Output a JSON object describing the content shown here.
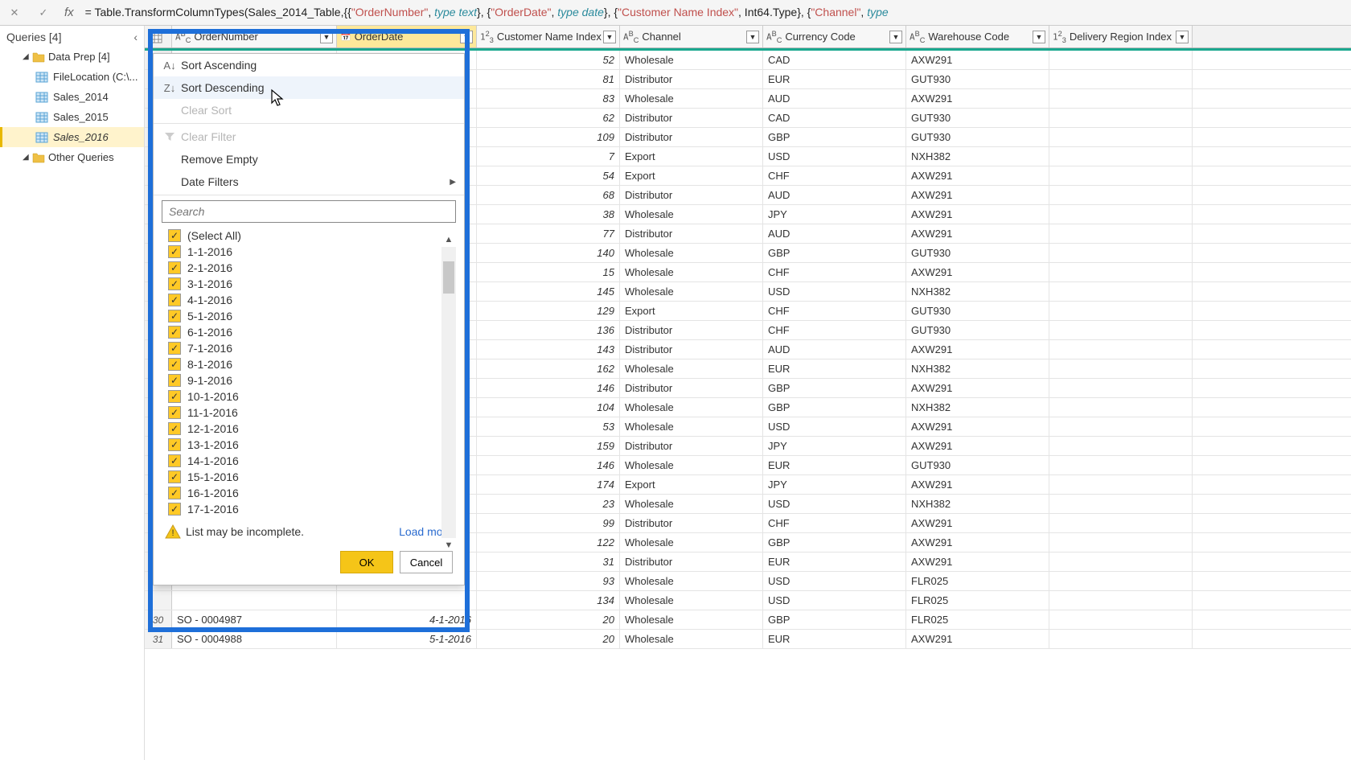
{
  "formula_parts": [
    "= Table.TransformColumnTypes(Sales_2014_Table,{{",
    "\"OrderNumber\"",
    ", ",
    "type text",
    "}, {",
    "\"OrderDate\"",
    ", ",
    "type date",
    "}, {",
    "\"Customer Name Index\"",
    ", Int64.Type}, {",
    "\"Channel\"",
    ", ",
    "type"
  ],
  "sidebar": {
    "title": "Queries [4]",
    "folder": "Data Prep [4]",
    "items": [
      "FileLocation (C:\\...",
      "Sales_2014",
      "Sales_2015",
      "Sales_2016"
    ],
    "other": "Other Queries"
  },
  "columns": [
    {
      "type": "ABC",
      "name": "OrderNumber"
    },
    {
      "type": "cal",
      "name": "OrderDate",
      "sel": true
    },
    {
      "type": "123",
      "name": "Customer Name Index"
    },
    {
      "type": "ABC",
      "name": "Channel"
    },
    {
      "type": "ABC",
      "name": "Currency Code"
    },
    {
      "type": "ABC",
      "name": "Warehouse Code"
    },
    {
      "type": "123",
      "name": "Delivery Region Index"
    }
  ],
  "visible_rows_bottom": [
    {
      "rn": "30",
      "order": "SO - 0004987",
      "date": "4-1-2016",
      "cust": "20",
      "chan": "Wholesale",
      "curr": "GBP",
      "wh": "FLR025"
    },
    {
      "rn": "31",
      "order": "SO - 0004988",
      "date": "5-1-2016",
      "cust": "20",
      "chan": "Wholesale",
      "curr": "EUR",
      "wh": "AXW291"
    }
  ],
  "rows": [
    {
      "cust": "52",
      "chan": "Wholesale",
      "curr": "CAD",
      "wh": "AXW291"
    },
    {
      "cust": "81",
      "chan": "Distributor",
      "curr": "EUR",
      "wh": "GUT930"
    },
    {
      "cust": "83",
      "chan": "Wholesale",
      "curr": "AUD",
      "wh": "AXW291"
    },
    {
      "cust": "62",
      "chan": "Distributor",
      "curr": "CAD",
      "wh": "GUT930"
    },
    {
      "cust": "109",
      "chan": "Distributor",
      "curr": "GBP",
      "wh": "GUT930"
    },
    {
      "cust": "7",
      "chan": "Export",
      "curr": "USD",
      "wh": "NXH382"
    },
    {
      "cust": "54",
      "chan": "Export",
      "curr": "CHF",
      "wh": "AXW291"
    },
    {
      "cust": "68",
      "chan": "Distributor",
      "curr": "AUD",
      "wh": "AXW291"
    },
    {
      "cust": "38",
      "chan": "Wholesale",
      "curr": "JPY",
      "wh": "AXW291"
    },
    {
      "cust": "77",
      "chan": "Distributor",
      "curr": "AUD",
      "wh": "AXW291"
    },
    {
      "cust": "140",
      "chan": "Wholesale",
      "curr": "GBP",
      "wh": "GUT930"
    },
    {
      "cust": "15",
      "chan": "Wholesale",
      "curr": "CHF",
      "wh": "AXW291"
    },
    {
      "cust": "145",
      "chan": "Wholesale",
      "curr": "USD",
      "wh": "NXH382"
    },
    {
      "cust": "129",
      "chan": "Export",
      "curr": "CHF",
      "wh": "GUT930"
    },
    {
      "cust": "136",
      "chan": "Distributor",
      "curr": "CHF",
      "wh": "GUT930"
    },
    {
      "cust": "143",
      "chan": "Distributor",
      "curr": "AUD",
      "wh": "AXW291"
    },
    {
      "cust": "162",
      "chan": "Wholesale",
      "curr": "EUR",
      "wh": "NXH382"
    },
    {
      "cust": "146",
      "chan": "Distributor",
      "curr": "GBP",
      "wh": "AXW291"
    },
    {
      "cust": "104",
      "chan": "Wholesale",
      "curr": "GBP",
      "wh": "NXH382"
    },
    {
      "cust": "53",
      "chan": "Wholesale",
      "curr": "USD",
      "wh": "AXW291"
    },
    {
      "cust": "159",
      "chan": "Distributor",
      "curr": "JPY",
      "wh": "AXW291"
    },
    {
      "cust": "146",
      "chan": "Wholesale",
      "curr": "EUR",
      "wh": "GUT930"
    },
    {
      "cust": "174",
      "chan": "Export",
      "curr": "JPY",
      "wh": "AXW291"
    },
    {
      "cust": "23",
      "chan": "Wholesale",
      "curr": "USD",
      "wh": "NXH382"
    },
    {
      "cust": "99",
      "chan": "Distributor",
      "curr": "CHF",
      "wh": "AXW291"
    },
    {
      "cust": "122",
      "chan": "Wholesale",
      "curr": "GBP",
      "wh": "AXW291"
    },
    {
      "cust": "31",
      "chan": "Distributor",
      "curr": "EUR",
      "wh": "AXW291"
    },
    {
      "cust": "93",
      "chan": "Wholesale",
      "curr": "USD",
      "wh": "FLR025"
    },
    {
      "cust": "134",
      "chan": "Wholesale",
      "curr": "USD",
      "wh": "FLR025"
    }
  ],
  "menu": {
    "sort_asc": "Sort Ascending",
    "sort_desc": "Sort Descending",
    "clear_sort": "Clear Sort",
    "clear_filter": "Clear Filter",
    "remove_empty": "Remove Empty",
    "date_filters": "Date Filters",
    "search_ph": "Search",
    "select_all": "(Select All)",
    "dates": [
      "1-1-2016",
      "2-1-2016",
      "3-1-2016",
      "4-1-2016",
      "5-1-2016",
      "6-1-2016",
      "7-1-2016",
      "8-1-2016",
      "9-1-2016",
      "10-1-2016",
      "11-1-2016",
      "12-1-2016",
      "13-1-2016",
      "14-1-2016",
      "15-1-2016",
      "16-1-2016",
      "17-1-2016"
    ],
    "incomplete": "List may be incomplete.",
    "load_more": "Load more",
    "ok": "OK",
    "cancel": "Cancel"
  }
}
